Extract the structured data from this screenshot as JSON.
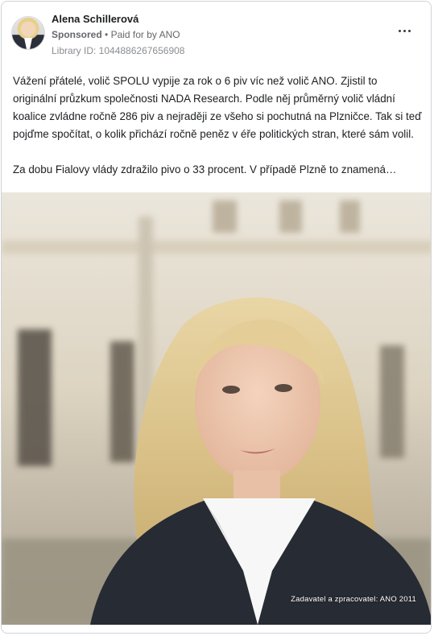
{
  "post": {
    "author_name": "Alena Schillerová",
    "sponsored_label": "Sponsored",
    "separator": "•",
    "paid_for_by": "Paid for by ANO",
    "library_id": "Library ID: 1044886267656908",
    "paragraphs": [
      "Vážení přátelé, volič SPOLU vypije za rok o 6 piv víc než volič ANO. Zjistil to originální průzkum společnosti NADA Research. Podle něj průměrný volič vládní koalice zvládne ročně 286 piv a nejraději ze všeho si pochutná na Plzničce. Tak si teď pojďme spočítat, o kolik přichází ročně peněz v éře politických stran, které sám volil.",
      "Za dobu Fialovy vlády zdražilo pivo o 33 procent. V případě Plzně to znamená…"
    ],
    "image_caption": "Zadavatel a zpracovatel: ANO 2011"
  },
  "icons": {
    "more": "more-horizontal-icon"
  }
}
